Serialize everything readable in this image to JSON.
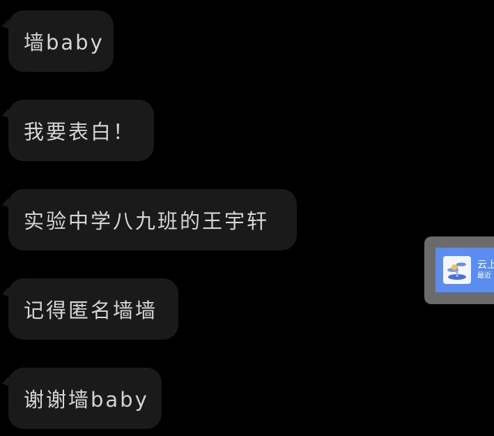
{
  "messages": [
    {
      "text": "墙baby"
    },
    {
      "text": "我要表白！"
    },
    {
      "text": "实验中学八九班的王宇轩"
    },
    {
      "text": "记得匿名墙墙"
    },
    {
      "text": "谢谢墙baby"
    }
  ],
  "floating_card": {
    "title": "云上",
    "subtitle": "最近",
    "icon": "stacked-discs-app-icon"
  },
  "colors": {
    "background": "#000000",
    "bubble": "#1a1a1a",
    "bubble_text": "#d6d6d6",
    "card_frame": "#6b6b6b",
    "card_fill": "#5b8df0"
  }
}
